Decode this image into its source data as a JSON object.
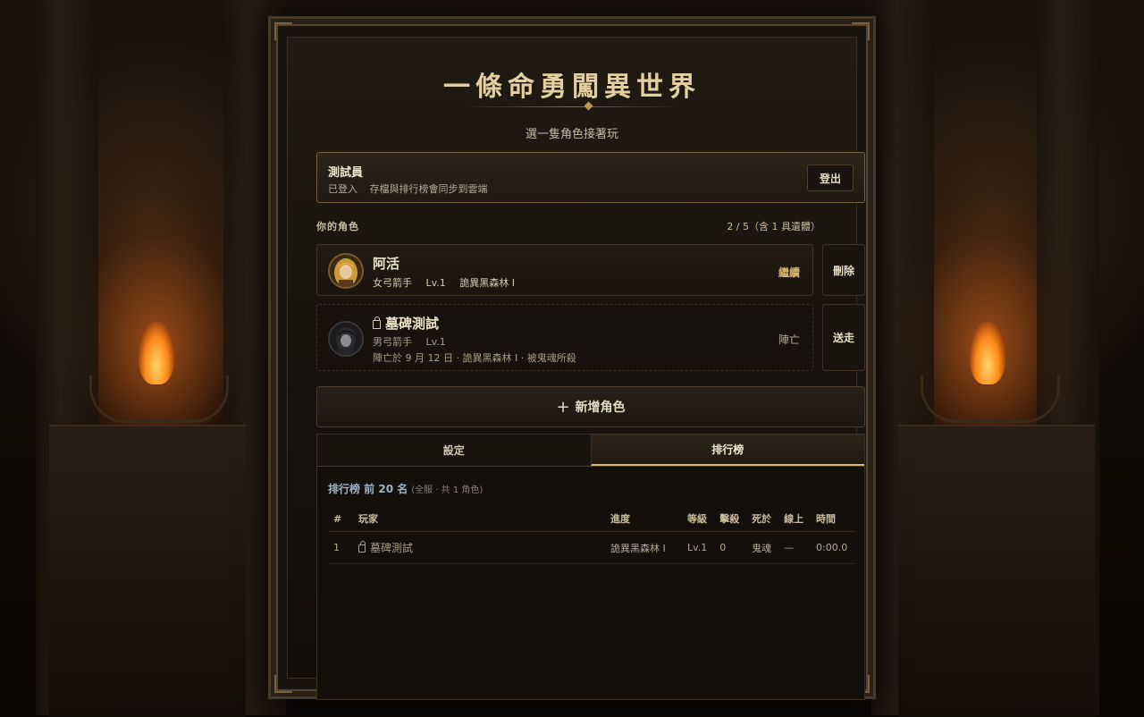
{
  "game": {
    "title": "一條命勇闖異世界",
    "subtitle": "選一隻角色接著玩"
  },
  "account": {
    "name": "測試員",
    "status": "已登入",
    "sync_note": "存檔與排行榜會同步到雲端",
    "logout_label": "登出"
  },
  "characters_section": {
    "heading": "你的角色",
    "count": "2 / 5（含 1 具遺體）"
  },
  "characters": [
    {
      "name": "阿活",
      "class": "女弓箭手",
      "level": "Lv.1",
      "location": "詭異黑森林 I",
      "action": "繼續",
      "side_action": "刪除"
    },
    {
      "name": "墓碑測試",
      "class": "男弓箭手",
      "level": "Lv.1",
      "death_note": "陣亡於 9 月 12 日 · 詭異黑森林 I · 被鬼魂所殺",
      "status": "陣亡",
      "side_action": "送走"
    }
  ],
  "new_character_label": "新增角色",
  "tabs": [
    {
      "label": "設定",
      "active": false
    },
    {
      "label": "排行榜",
      "active": true
    }
  ],
  "leaderboard": {
    "title": "排行榜 前 20 名",
    "subtitle": "(全服 · 共 1 角色)",
    "columns": [
      "#",
      "玩家",
      "進度",
      "等級",
      "擊殺",
      "死於",
      "線上",
      "時間"
    ],
    "rows": [
      [
        "1",
        "墓碑測試",
        "詭異黑森林 I",
        "Lv.1",
        "0",
        "鬼魂",
        "—",
        "0:00.0"
      ]
    ]
  },
  "colors": {
    "accent_gold": "#d8b56a",
    "title_gold": "#e3cf9f",
    "leaderboard_title": "#9fb3c8"
  },
  "icons": [
    "lock-icon",
    "plus-icon",
    "female-archer-portrait",
    "male-archer-portrait"
  ]
}
